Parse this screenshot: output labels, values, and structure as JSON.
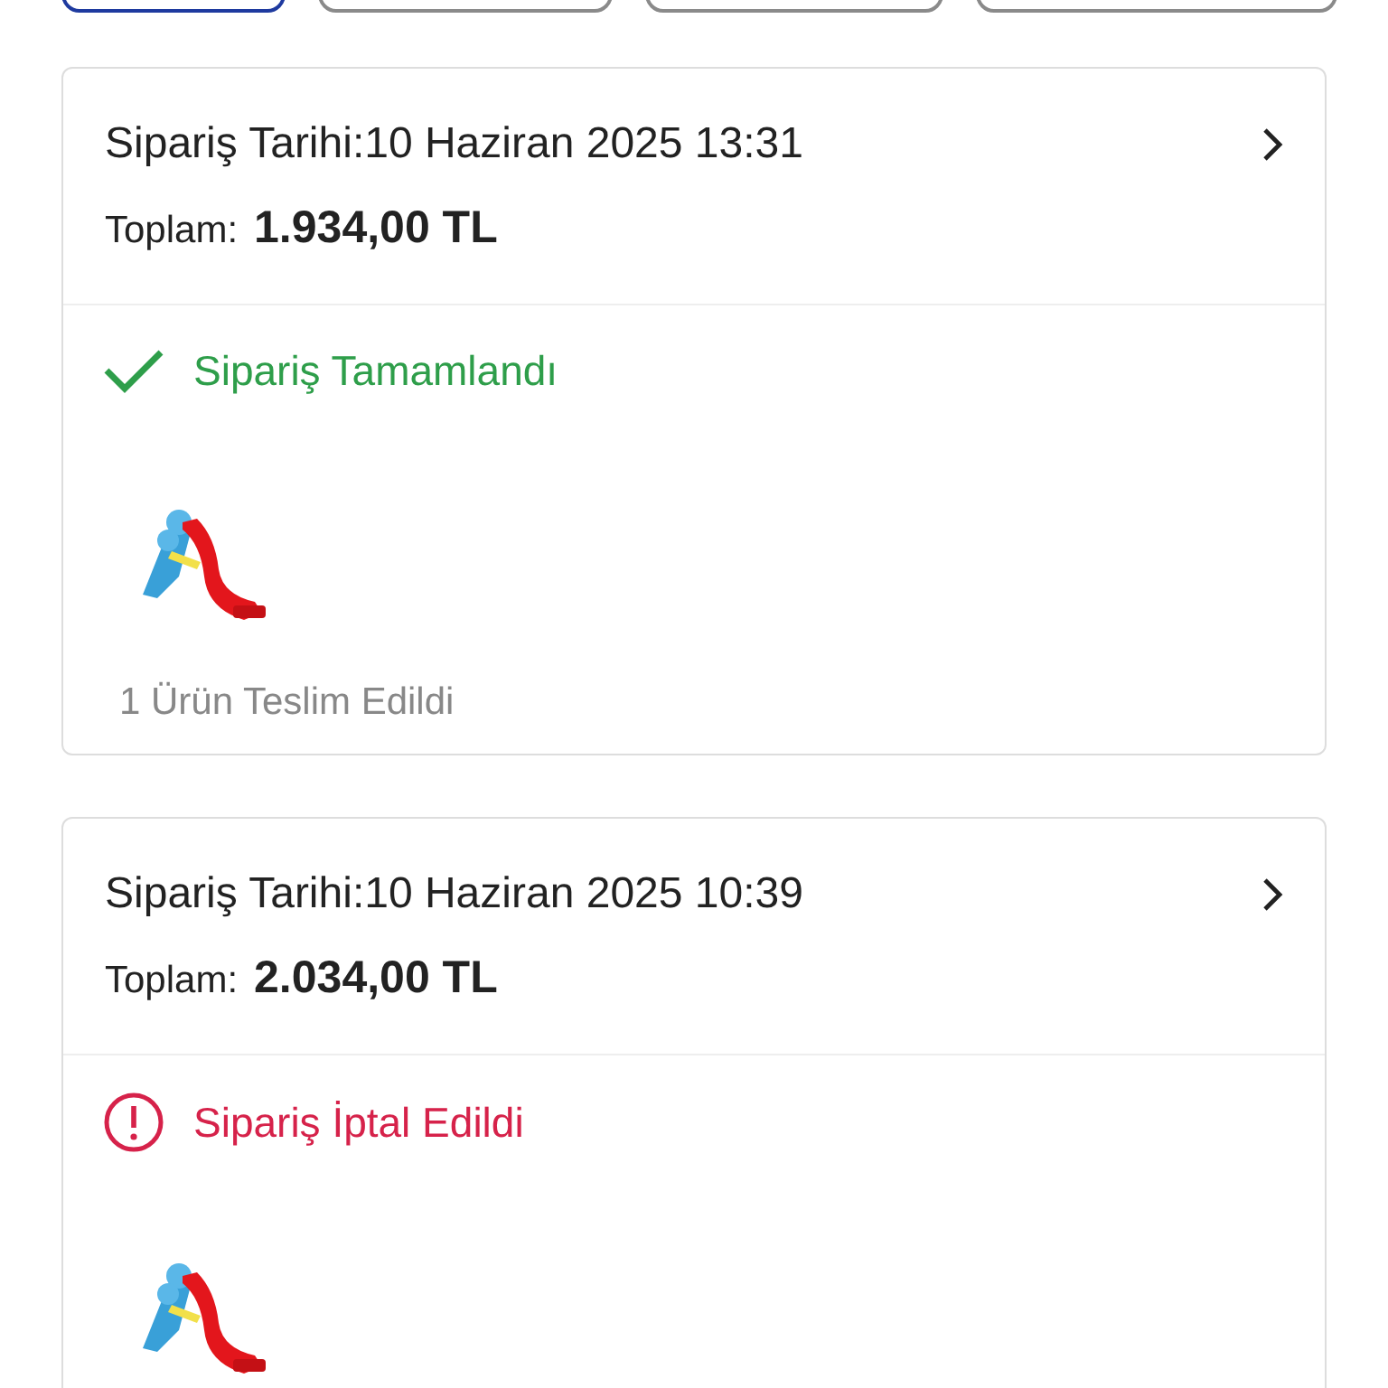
{
  "filters": [
    {
      "selected": true
    },
    {
      "selected": false
    },
    {
      "selected": false
    },
    {
      "selected": false
    }
  ],
  "orders": [
    {
      "date_label": "Sipariş Tarihi:",
      "date": "10 Haziran 2025 13:31",
      "total_label": "Toplam:",
      "total": "1.934,00 TL",
      "status": {
        "kind": "completed",
        "text": "Sipariş Tamamlandı"
      },
      "footer": "1 Ürün Teslim Edildi"
    },
    {
      "date_label": "Sipariş Tarihi:",
      "date": "10 Haziran 2025 10:39",
      "total_label": "Toplam:",
      "total": "2.034,00 TL",
      "status": {
        "kind": "cancelled",
        "text": "Sipariş İptal Edildi"
      }
    }
  ]
}
